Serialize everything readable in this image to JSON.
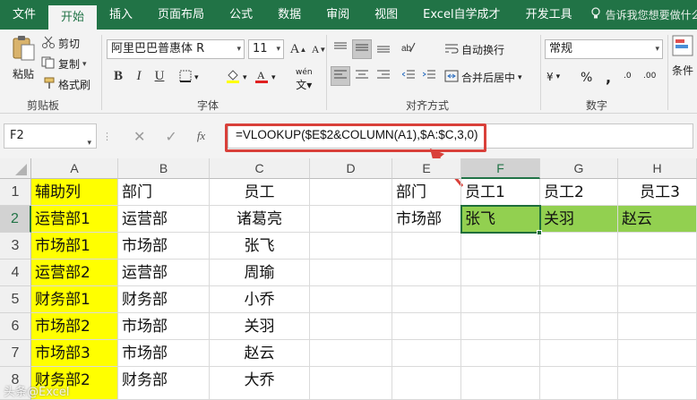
{
  "menu": {
    "tabs": [
      "文件",
      "开始",
      "插入",
      "页面布局",
      "公式",
      "数据",
      "审阅",
      "视图",
      "Excel自学成才",
      "开发工具"
    ],
    "active_tab": "开始",
    "tell_me": "告诉我您想要做什么"
  },
  "ribbon": {
    "clipboard": {
      "paste": "粘贴",
      "cut": "剪切",
      "copy": "复制",
      "format_painter": "格式刷",
      "label": "剪贴板"
    },
    "font": {
      "name": "阿里巴巴普惠体 R",
      "size": "11",
      "bold": "B",
      "italic": "I",
      "underline": "U",
      "grow": "A",
      "shrink": "A",
      "wen": "wén",
      "label": "字体"
    },
    "alignment": {
      "wrap": "自动换行",
      "merge": "合并后居中",
      "label": "对齐方式"
    },
    "number": {
      "format": "常规",
      "label": "数字",
      "percent": "%",
      "comma": ",",
      "currency": "¥",
      "inc": ".0",
      "dec": ".00"
    },
    "styles": {
      "cond": "条件"
    }
  },
  "formula_bar": {
    "name_box": "F2",
    "fx": "fx",
    "formula": "=VLOOKUP($E$2&COLUMN(A1),$A:$C,3,0)"
  },
  "sheet": {
    "columns": [
      "A",
      "B",
      "C",
      "D",
      "E",
      "F",
      "G",
      "H"
    ],
    "selected_column": "F",
    "rows": [
      "1",
      "2",
      "3",
      "4",
      "5",
      "6",
      "7",
      "8"
    ],
    "selected_row": "2",
    "A": [
      "辅助列",
      "运营部1",
      "市场部1",
      "运营部2",
      "财务部1",
      "市场部2",
      "市场部3",
      "财务部2"
    ],
    "B": [
      "部门",
      "运营部",
      "市场部",
      "运营部",
      "财务部",
      "市场部",
      "市场部",
      "财务部"
    ],
    "C": [
      "员工",
      "诸葛亮",
      "张飞",
      "周瑜",
      "小乔",
      "关羽",
      "赵云",
      "大乔"
    ],
    "E1": "部门",
    "E2": "市场部",
    "F1": "员工1",
    "G1": "员工2",
    "H1": "员工3",
    "F2": "张飞",
    "G2": "关羽",
    "H2": "赵云"
  },
  "watermark": "头条@Excel",
  "colors": {
    "excel_green": "#217346",
    "highlight_yellow": "#ffff00",
    "result_green": "#92d050",
    "callout_red": "#d9403a"
  }
}
